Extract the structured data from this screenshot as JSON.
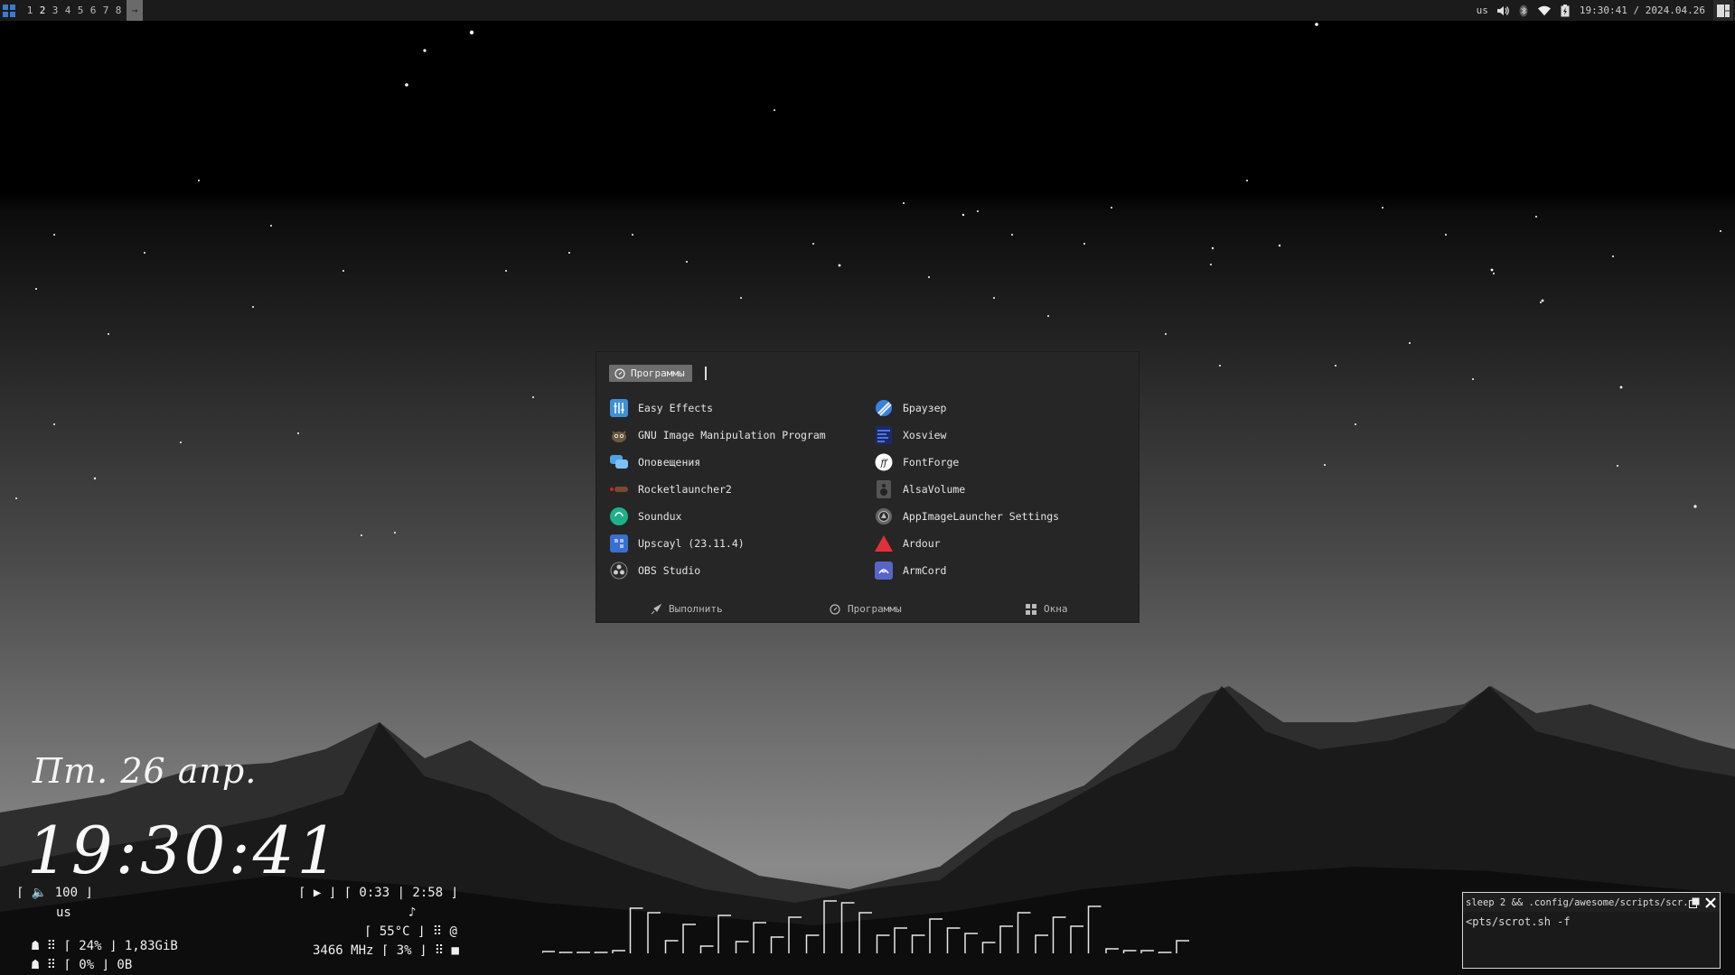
{
  "topbar": {
    "tags": [
      "1",
      "2",
      "3",
      "4",
      "5",
      "6",
      "7",
      "8"
    ],
    "active_tag": "2",
    "arrow_label": "→",
    "keyboard_layout": "us",
    "clock": "19:30:41 / 2024.04.26"
  },
  "launcher": {
    "mode_label": "Программы",
    "apps_left": [
      "Easy Effects",
      "GNU Image Manipulation Program",
      "Оповещения",
      "Rocketlauncher2",
      "Soundux",
      "Upscayl (23.11.4)",
      "OBS Studio"
    ],
    "apps_right": [
      "Браузер",
      "Xosview",
      "FontForge",
      "AlsaVolume",
      "AppImageLauncher Settings",
      "Ardour",
      "ArmCord"
    ],
    "footer": {
      "run": "Выполнить",
      "programs": "Программы",
      "windows": "Окна"
    }
  },
  "clock_widget": {
    "date": "Пт. 26 апр.",
    "time": "19:30:41"
  },
  "stats": {
    "volume": "⌈ 🔈 100 ⌋",
    "layout": "us",
    "memory": "⠿ ⌈ 24% ⌋ 1,83GiB",
    "swap": "⠿ ⌈ 0% ⌋ 0B",
    "player": "⌈ ▶ ⌋ ⌈ 0:33 | 2:58 ⌋",
    "music_note": "♪",
    "temp": "⌈ 55°C ⌋ ⠿ @",
    "cpu": "3466 MHz ⌈ 3% ⌋ ⠿ ■"
  },
  "visualizer": [
    2,
    0,
    1,
    1,
    3,
    50,
    45,
    14,
    32,
    8,
    42,
    13,
    34,
    18,
    40,
    20,
    58,
    56,
    45,
    20,
    28,
    20,
    38,
    28,
    22,
    12,
    30,
    45,
    20,
    40,
    30,
    52,
    5,
    3,
    3,
    0,
    14
  ],
  "terminal": {
    "title": "sleep 2 && .config/awesome/scripts/scr...",
    "body": "<pts/scrot.sh -f"
  }
}
